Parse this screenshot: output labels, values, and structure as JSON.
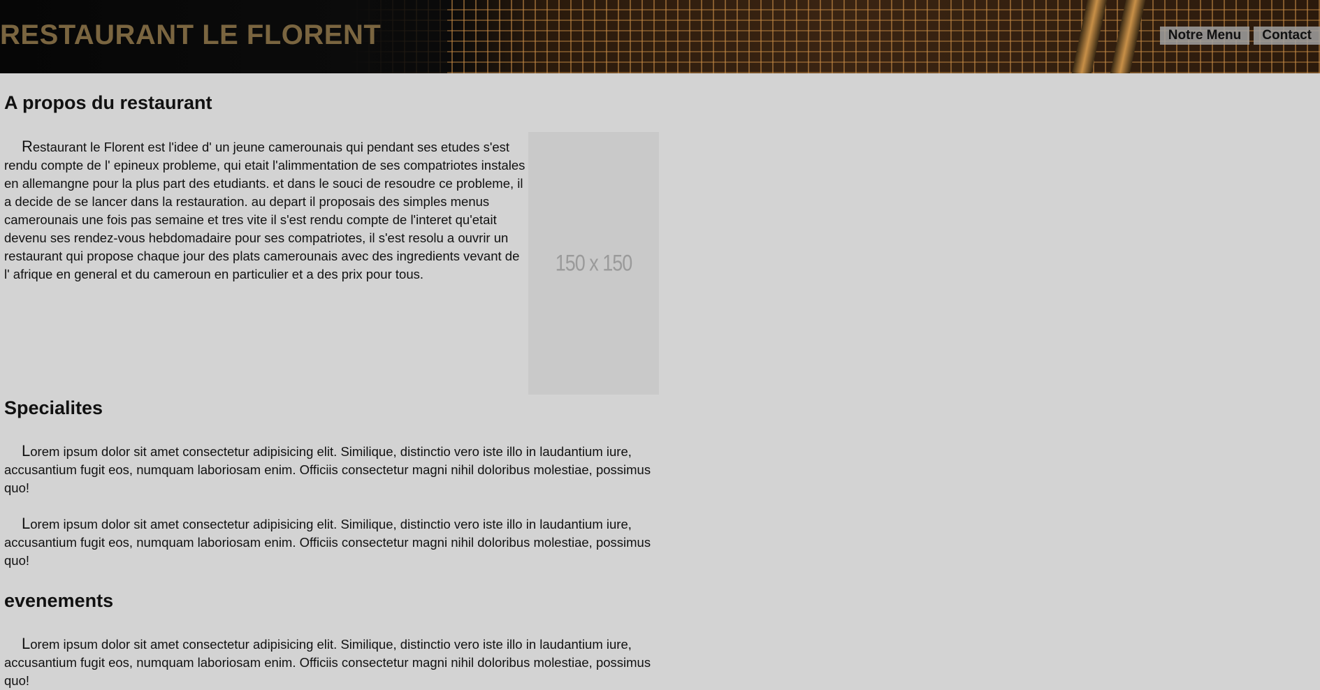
{
  "header": {
    "title": "RESTAURANT LE FLORENT",
    "nav": [
      "Notre Menu",
      "Contact"
    ]
  },
  "about": {
    "heading": "A propos du restaurant",
    "first_letter": "R",
    "text": "estaurant le Florent est l'idee d' un jeune camerounais qui pendant ses etudes s'est rendu compte de l' epineux probleme, qui etait l'alimmentation de ses compatriotes instales en allemangne pour la plus part des etudiants. et dans le souci de resoudre ce probleme, il a decide de se lancer dans la restauration. au depart il proposais des simples menus camerounais une fois pas semaine et tres vite il s'est rendu compte de l'interet qu'etait devenu ses rendez-vous hebdomadaire pour ses compatriotes, il s'est resolu a ouvrir un restaurant qui propose chaque jour des plats camerounais avec des ingredients vevant de l' afrique en general et du cameroun en particulier et a des prix pour tous.",
    "image_label": "150 x 150"
  },
  "specialites": {
    "heading": "Specialites",
    "paragraphs": [
      {
        "first_letter": "L",
        "text": "orem ipsum dolor sit amet consectetur adipisicing elit. Similique, distinctio vero iste illo in laudantium iure, accusantium fugit eos, numquam laboriosam enim. Officiis consectetur magni nihil doloribus molestiae, possimus quo!"
      },
      {
        "first_letter": "L",
        "text": "orem ipsum dolor sit amet consectetur adipisicing elit. Similique, distinctio vero iste illo in laudantium iure, accusantium fugit eos, numquam laboriosam enim. Officiis consectetur magni nihil doloribus molestiae, possimus quo!"
      }
    ]
  },
  "evenements": {
    "heading": "evenements",
    "paragraphs": [
      {
        "first_letter": "L",
        "text": "orem ipsum dolor sit amet consectetur adipisicing elit. Similique, distinctio vero iste illo in laudantium iure, accusantium fugit eos, numquam laboriosam enim. Officiis consectetur magni nihil doloribus molestiae, possimus quo!"
      }
    ]
  },
  "colors": {
    "background": "#d3d3d3",
    "title": "#7a6540",
    "nav_bg": "#a0a0a0",
    "placeholder_bg": "#c9c9c9"
  }
}
